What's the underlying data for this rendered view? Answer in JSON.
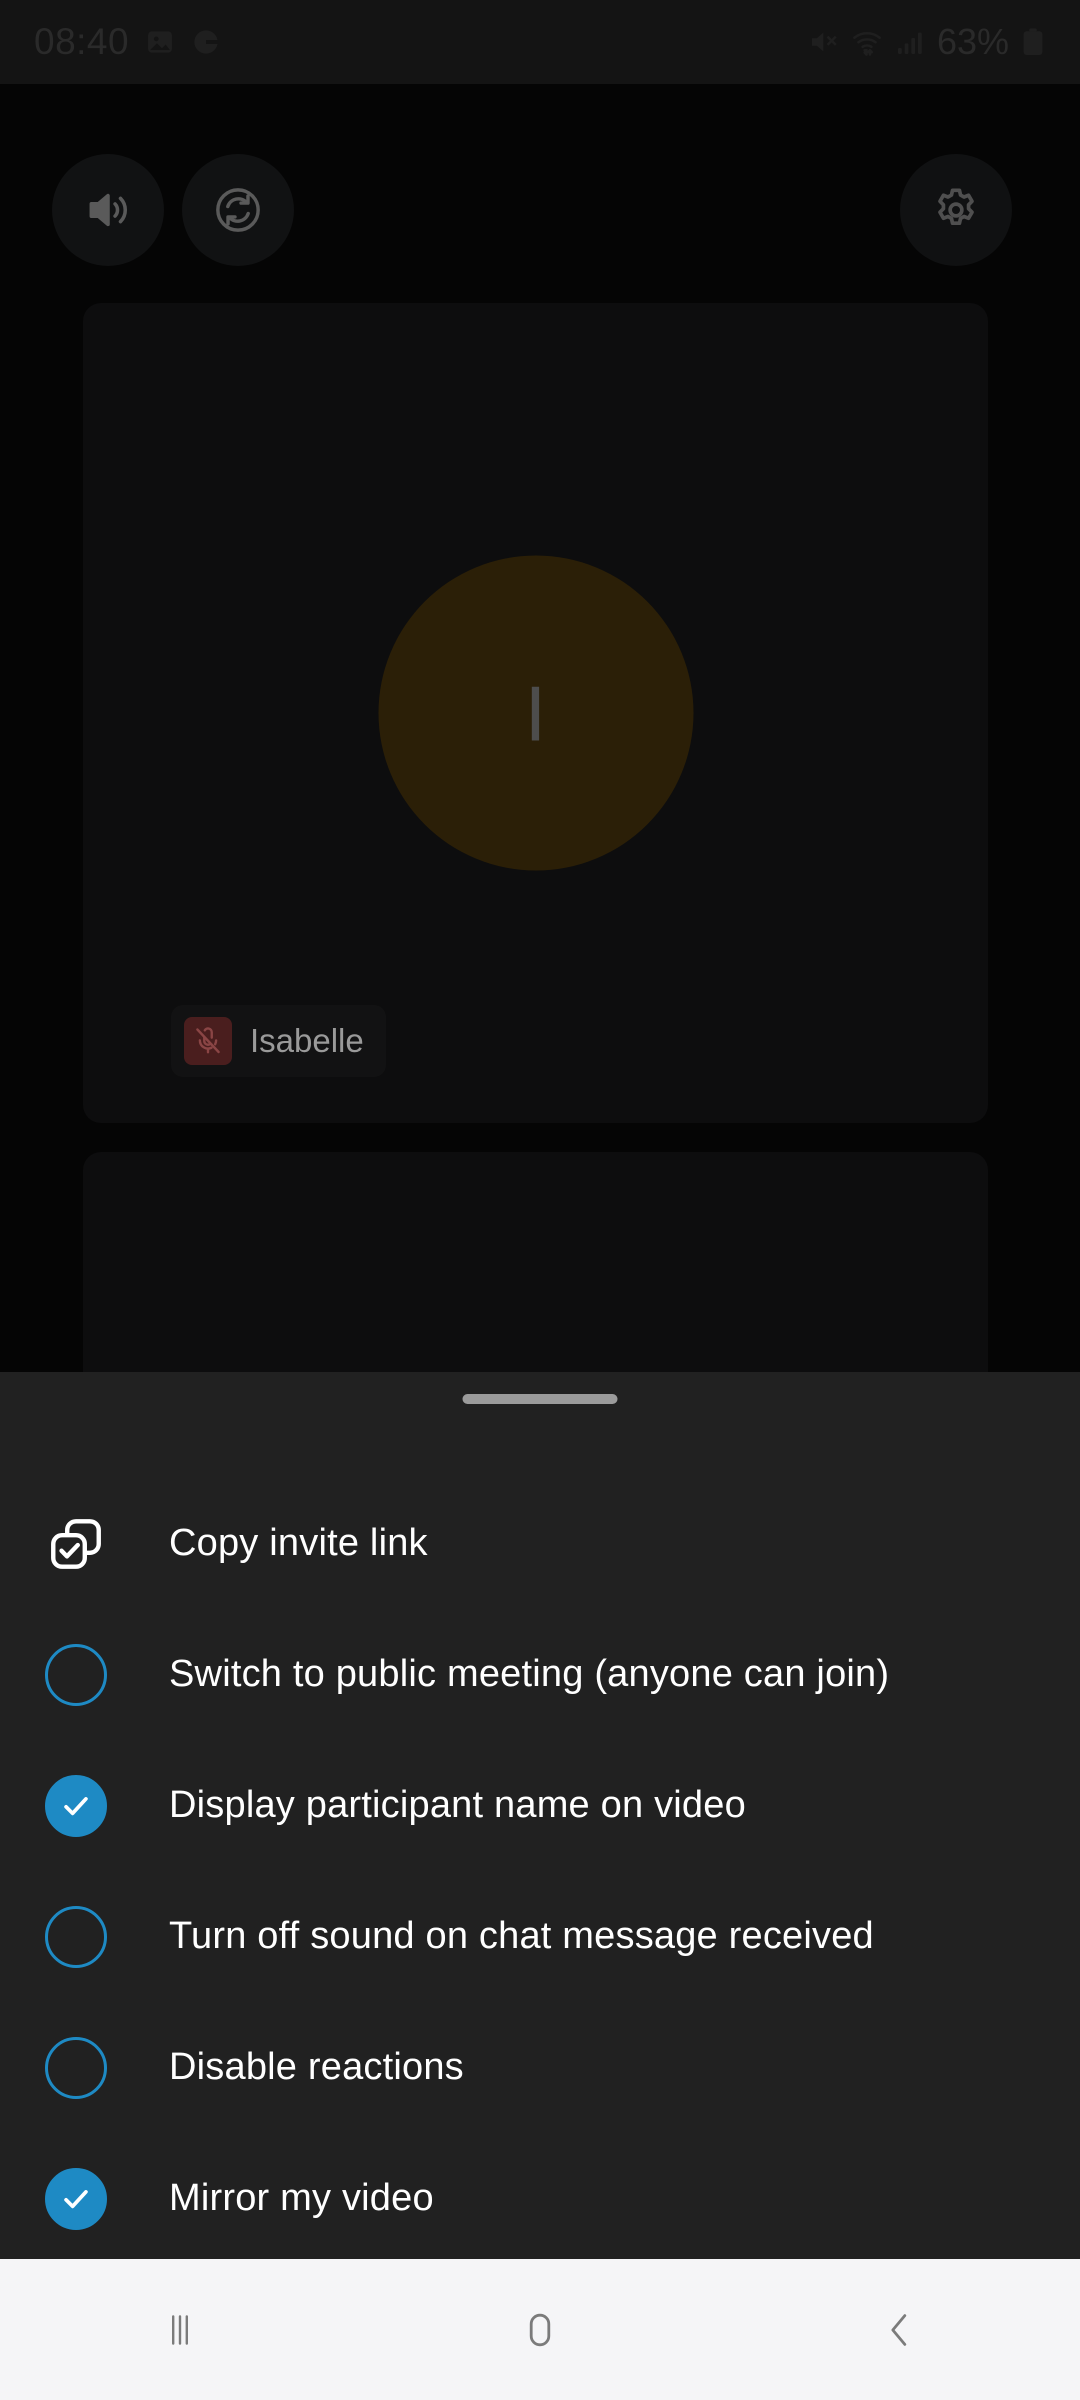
{
  "status_bar": {
    "time": "08:40",
    "battery_percent": "63%",
    "left_icons": [
      "image-icon",
      "google-icon"
    ],
    "right_icons": [
      "mute-icon",
      "wifi-icon",
      "signal-icon",
      "battery-icon"
    ]
  },
  "top_controls": {
    "speaker_label": "speaker-icon",
    "flip_camera_label": "flip-camera-icon",
    "settings_label": "gear-icon"
  },
  "video": {
    "participant_name": "Isabelle",
    "avatar_initial": "I",
    "avatar_color": "#2b1f07",
    "muted": true
  },
  "sheet": {
    "accent_color": "#1e8ac4",
    "background_color": "#212121",
    "items": [
      {
        "label": "Copy invite link",
        "type": "action",
        "icon": "copy-check-icon"
      },
      {
        "label": "Switch to public meeting (anyone can join)",
        "type": "checkbox",
        "checked": false
      },
      {
        "label": "Display participant name on video",
        "type": "checkbox",
        "checked": true
      },
      {
        "label": "Turn off sound on chat message received",
        "type": "checkbox",
        "checked": false
      },
      {
        "label": "Disable reactions",
        "type": "checkbox",
        "checked": false
      },
      {
        "label": "Mirror my video",
        "type": "checkbox",
        "checked": true
      }
    ]
  },
  "nav_bar": {
    "recents_label": "recents-icon",
    "home_label": "home-icon",
    "back_label": "back-icon"
  }
}
